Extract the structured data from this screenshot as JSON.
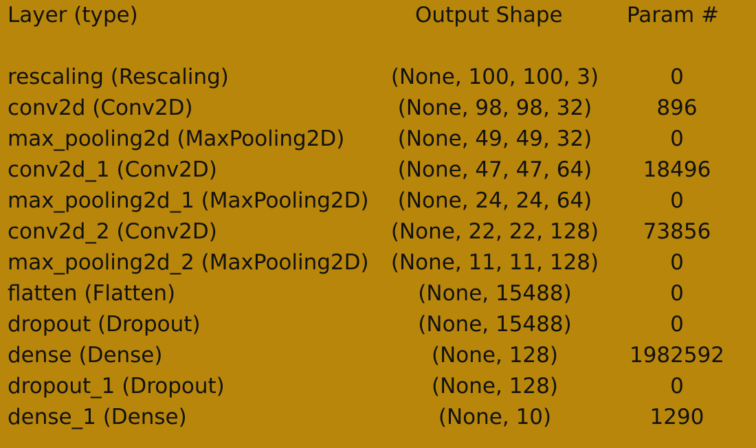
{
  "headers": {
    "layer": "Layer (type)",
    "output_shape": "Output Shape",
    "params": "Param #"
  },
  "rows": [
    {
      "layer": "rescaling (Rescaling)",
      "shape": "(None, 100, 100, 3)",
      "params": "0"
    },
    {
      "layer": "conv2d (Conv2D)",
      "shape": "(None, 98, 98, 32)",
      "params": "896"
    },
    {
      "layer": "max_pooling2d (MaxPooling2D)",
      "shape": "(None, 49, 49, 32)",
      "params": "0"
    },
    {
      "layer": "conv2d_1 (Conv2D)",
      "shape": "(None, 47, 47, 64)",
      "params": "18496"
    },
    {
      "layer": "max_pooling2d_1 (MaxPooling2D)",
      "shape": "(None, 24, 24, 64)",
      "params": "0"
    },
    {
      "layer": "conv2d_2 (Conv2D)",
      "shape": "(None, 22, 22, 128)",
      "params": "73856"
    },
    {
      "layer": "max_pooling2d_2 (MaxPooling2D)",
      "shape": "(None, 11, 11, 128)",
      "params": "0"
    },
    {
      "layer": "flatten (Flatten)",
      "shape": "(None, 15488)",
      "params": "0"
    },
    {
      "layer": "dropout (Dropout)",
      "shape": "(None, 15488)",
      "params": "0"
    },
    {
      "layer": "dense (Dense)",
      "shape": "(None, 128)",
      "params": "1982592"
    },
    {
      "layer": "dropout_1 (Dropout)",
      "shape": "(None, 128)",
      "params": "0"
    },
    {
      "layer": "dense_1 (Dense)",
      "shape": "(None, 10)",
      "params": "1290"
    }
  ]
}
